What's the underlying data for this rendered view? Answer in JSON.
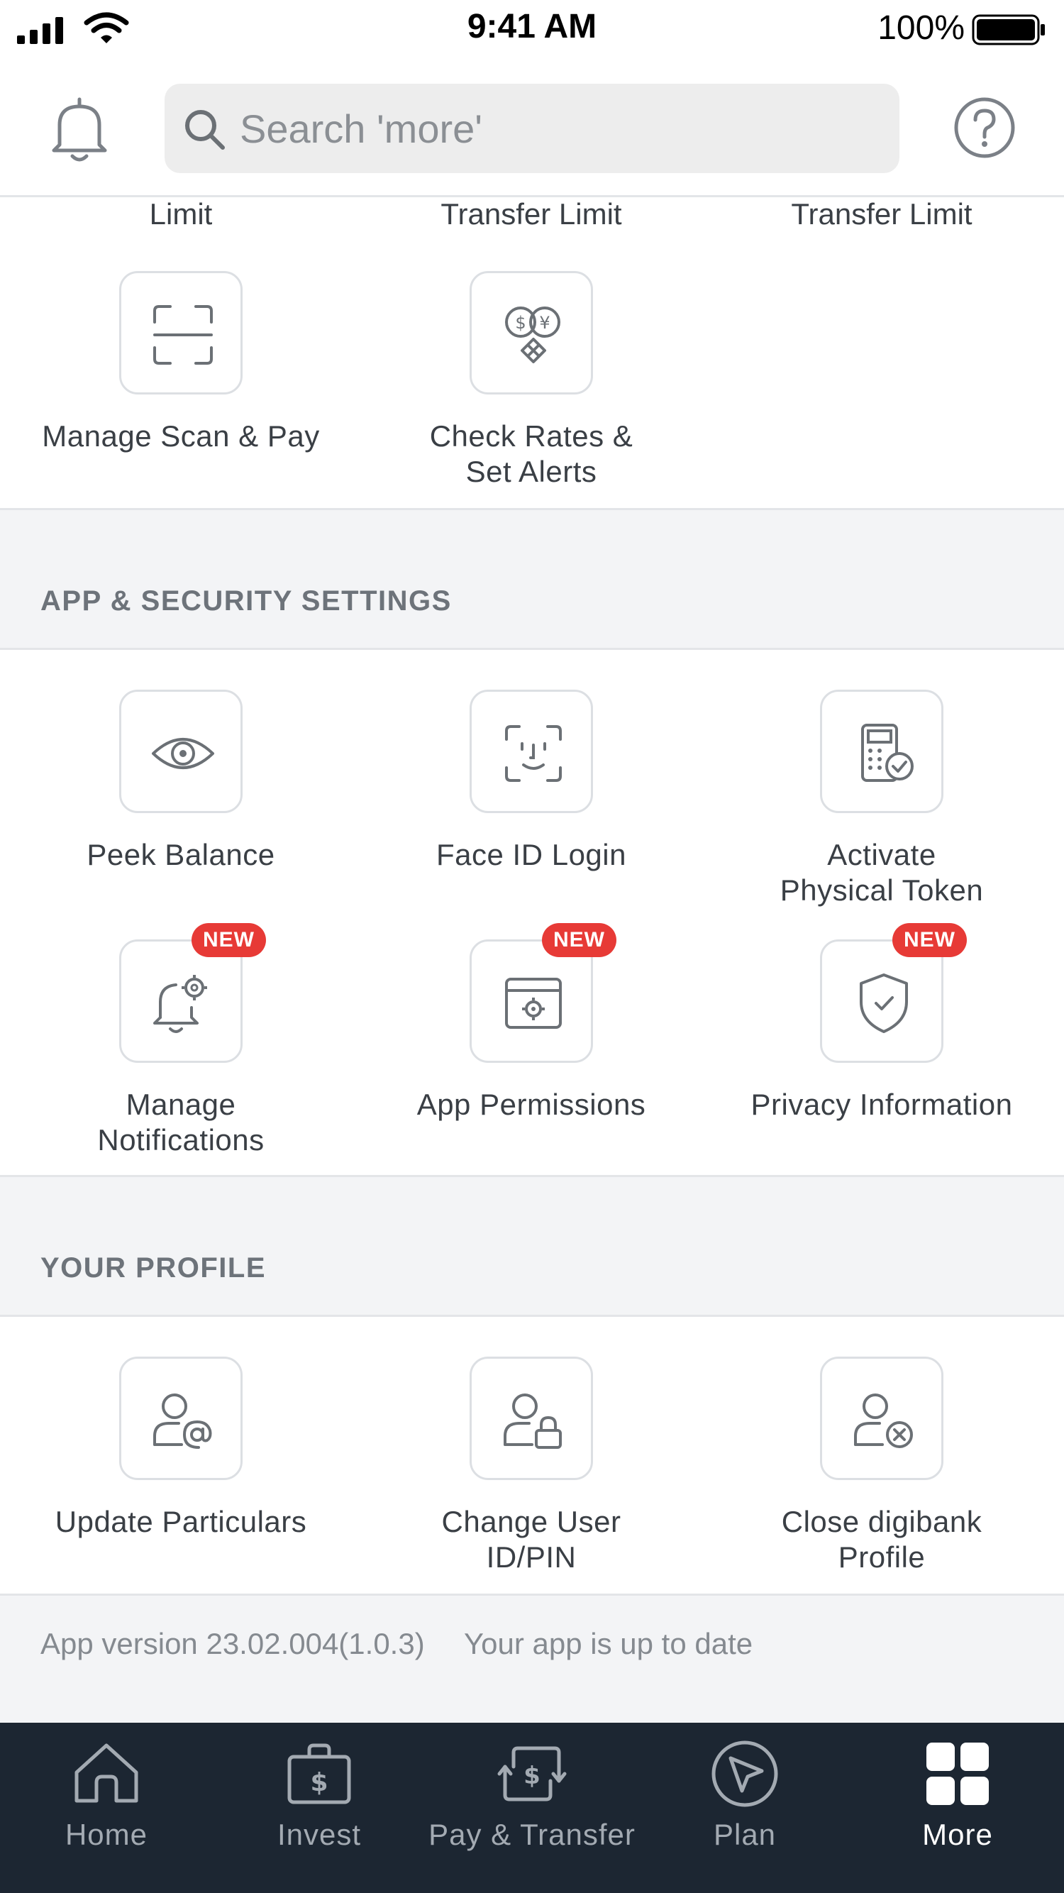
{
  "status_bar": {
    "time": "9:41 AM",
    "battery": "100%",
    "icons": [
      "signal-icon",
      "wifi-icon",
      "battery-icon"
    ]
  },
  "header": {
    "search_placeholder": "Search 'more'",
    "icons": [
      "bell-icon",
      "search-icon",
      "help-icon"
    ]
  },
  "partial_row": {
    "labels": [
      "Limit",
      "Transfer Limit",
      "Transfer Limit"
    ]
  },
  "payments_tiles": [
    {
      "label": "Manage Scan & Pay",
      "icon": "scan-icon"
    },
    {
      "label": "Check Rates &\nSet Alerts",
      "icon": "currency-exchange-icon"
    }
  ],
  "app_security": {
    "title": "APP & SECURITY SETTINGS",
    "tiles": [
      {
        "label": "Peek Balance",
        "icon": "eye-icon",
        "badge": ""
      },
      {
        "label": "Face ID Login",
        "icon": "face-id-icon",
        "badge": ""
      },
      {
        "label": "Activate\nPhysical Token",
        "icon": "token-icon",
        "badge": ""
      },
      {
        "label": "Manage\nNotifications",
        "icon": "bell-gear-icon",
        "badge": "NEW"
      },
      {
        "label": "App Permissions",
        "icon": "app-settings-icon",
        "badge": "NEW"
      },
      {
        "label": "Privacy Information",
        "icon": "shield-check-icon",
        "badge": "NEW"
      }
    ]
  },
  "profile": {
    "title": "YOUR PROFILE",
    "tiles": [
      {
        "label": "Update Particulars",
        "icon": "user-at-icon"
      },
      {
        "label": "Change User\nID/PIN",
        "icon": "user-lock-icon"
      },
      {
        "label": "Close digibank\nProfile",
        "icon": "user-close-icon"
      }
    ]
  },
  "footer": {
    "version": "App version 23.02.004(1.0.3)",
    "update_status": "Your app is up to date"
  },
  "bottom_nav": {
    "items": [
      {
        "label": "Home",
        "icon": "home-icon",
        "active": false
      },
      {
        "label": "Invest",
        "icon": "invest-icon",
        "active": false
      },
      {
        "label": "Pay & Transfer",
        "icon": "pay-transfer-icon",
        "active": false
      },
      {
        "label": "Plan",
        "icon": "plan-icon",
        "active": false
      },
      {
        "label": "More",
        "icon": "more-grid-icon",
        "active": true
      }
    ]
  },
  "colors": {
    "badge": "#e73a36",
    "nav_background": "#1c2632",
    "section_background": "#f3f4f6"
  }
}
